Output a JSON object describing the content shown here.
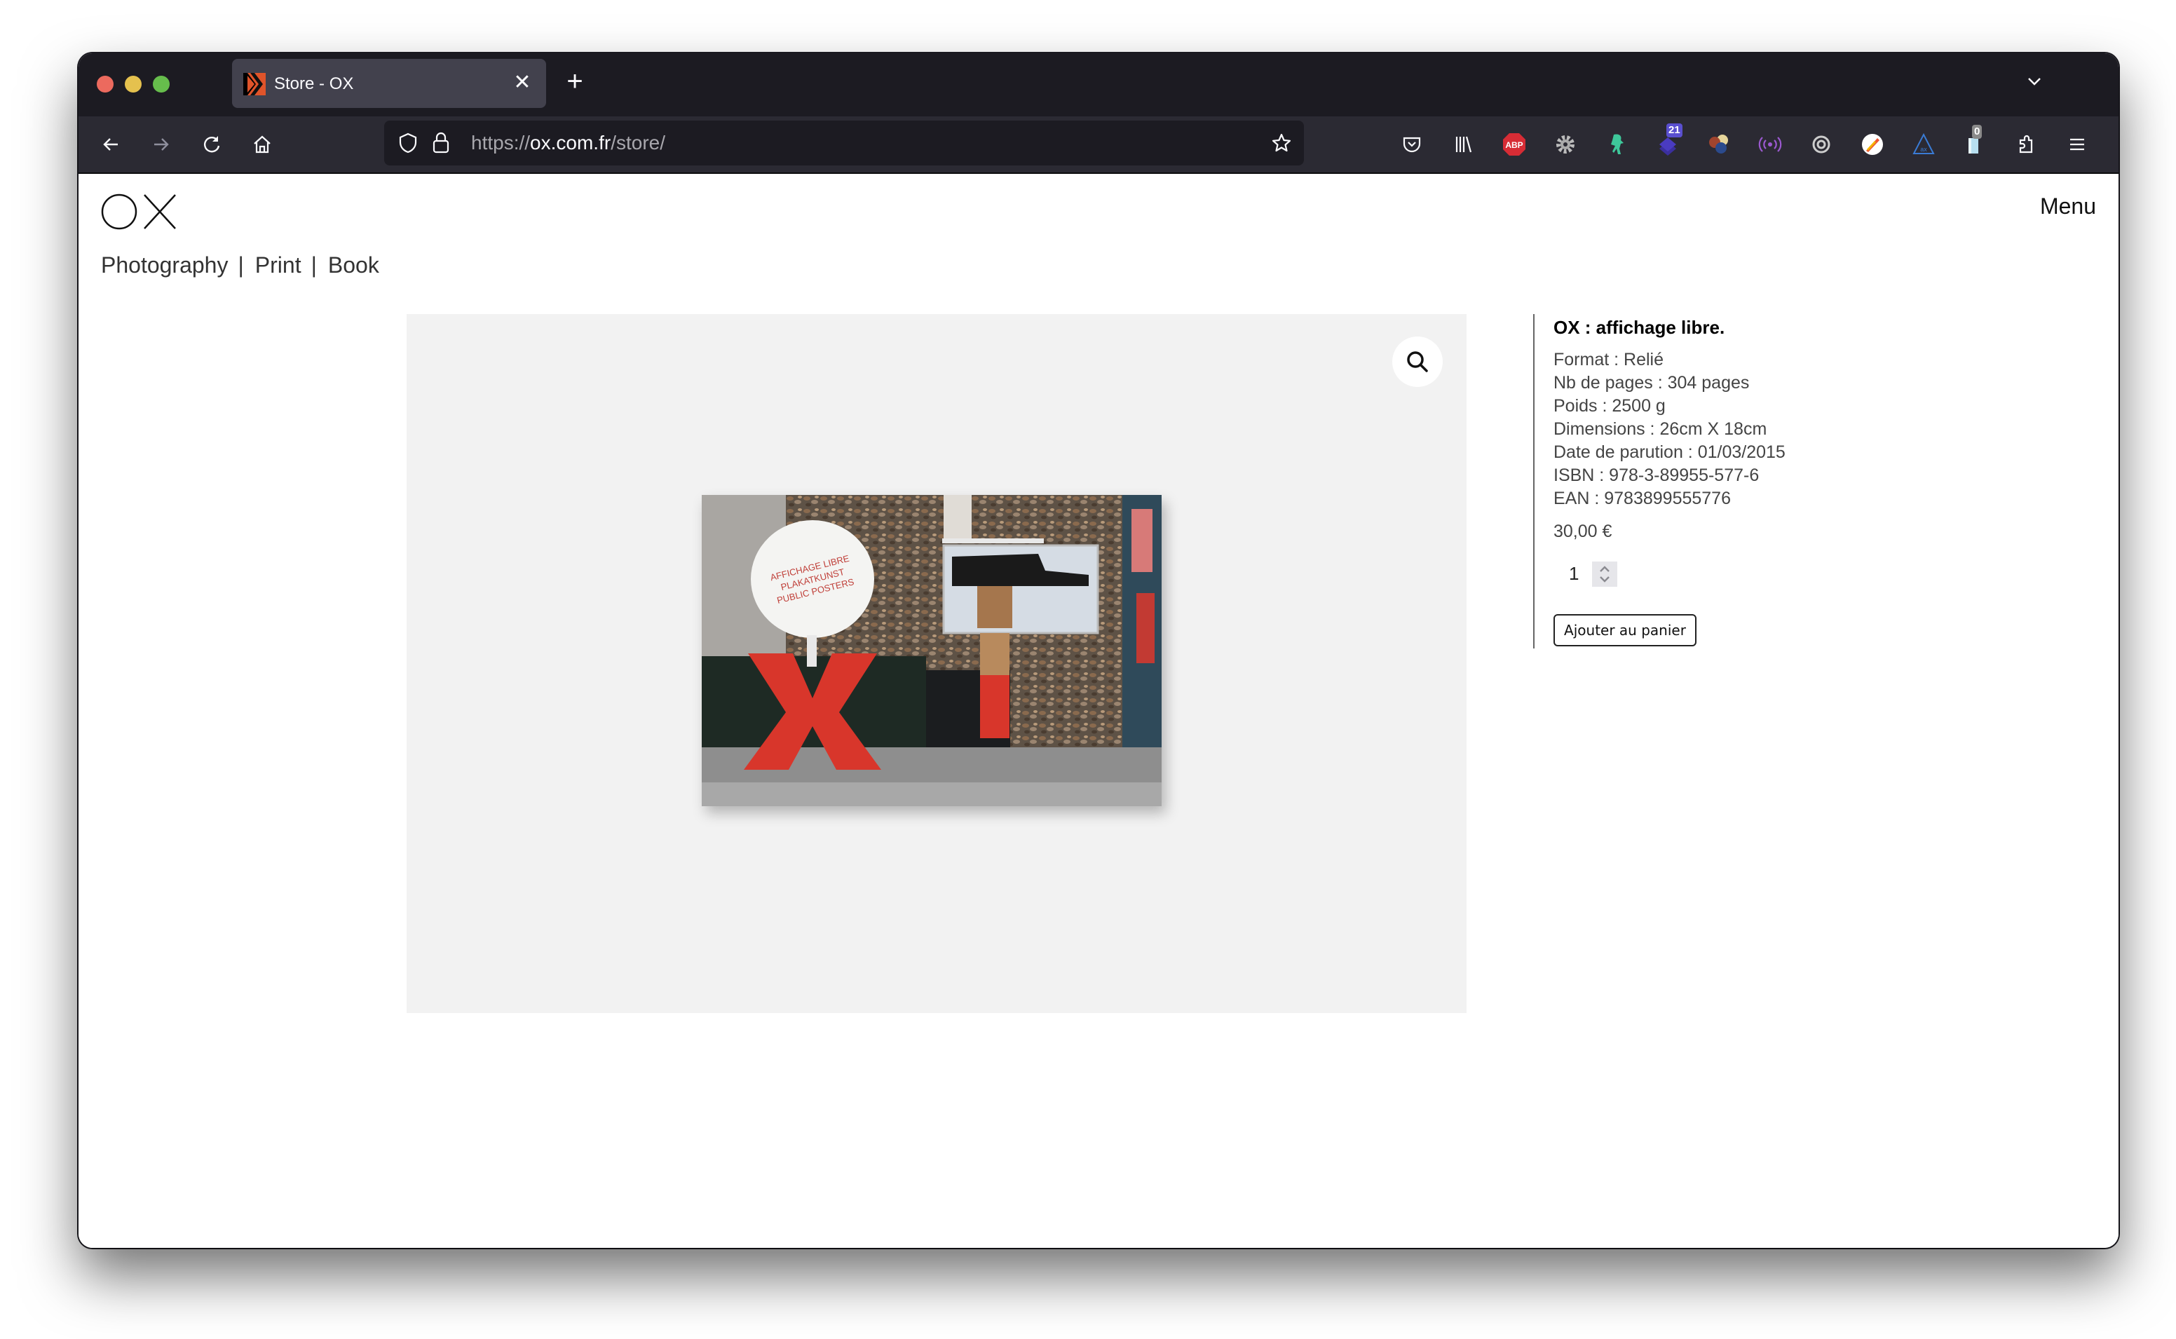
{
  "browser": {
    "tab": {
      "title": "Store - OX",
      "favicon": "ox-favicon-icon"
    },
    "url": {
      "scheme": "https://",
      "host": "ox.com.fr",
      "path": "/store/"
    },
    "extensions": [
      {
        "name": "pocket-icon"
      },
      {
        "name": "library-icon"
      },
      {
        "name": "adblock-plus-icon",
        "label": "ABP"
      },
      {
        "name": "settings-gear-icon"
      },
      {
        "name": "ghost-extension-icon"
      },
      {
        "name": "layers-extension-icon",
        "badge": "21"
      },
      {
        "name": "color-balls-icon"
      },
      {
        "name": "broadcast-icon"
      },
      {
        "name": "sync-icon"
      },
      {
        "name": "colorful-pen-icon"
      },
      {
        "name": "triangle-ax-icon"
      },
      {
        "name": "clipboard-extension-icon",
        "badge": "0"
      },
      {
        "name": "extensions-puzzle-icon"
      },
      {
        "name": "hamburger-menu-icon"
      }
    ]
  },
  "site": {
    "logo": "OX",
    "menu_label": "Menu",
    "nav": [
      "Photography",
      "Print",
      "Book"
    ],
    "nav_separator": "|"
  },
  "product": {
    "title": "OX : affichage libre.",
    "attributes": [
      "Format : Relié",
      "Nb de pages : 304 pages",
      "Poids : 2500 g",
      "Dimensions : 26cm X 18cm",
      "Date de parution : 01/03/2015",
      "ISBN : 978-3-89955-577-6",
      "EAN : 9783899555776"
    ],
    "price": "30,00 €",
    "quantity": "1",
    "add_to_cart_label": "Ajouter au panier",
    "cover_text": [
      "AFFICHAGE LIBRE",
      "PLAKATKUNST",
      "PUBLIC POSTERS"
    ]
  },
  "colors": {
    "accent_red": "#d8362b",
    "toolbar_bg": "#2b2a33",
    "titlebar_bg": "#1c1b22"
  }
}
